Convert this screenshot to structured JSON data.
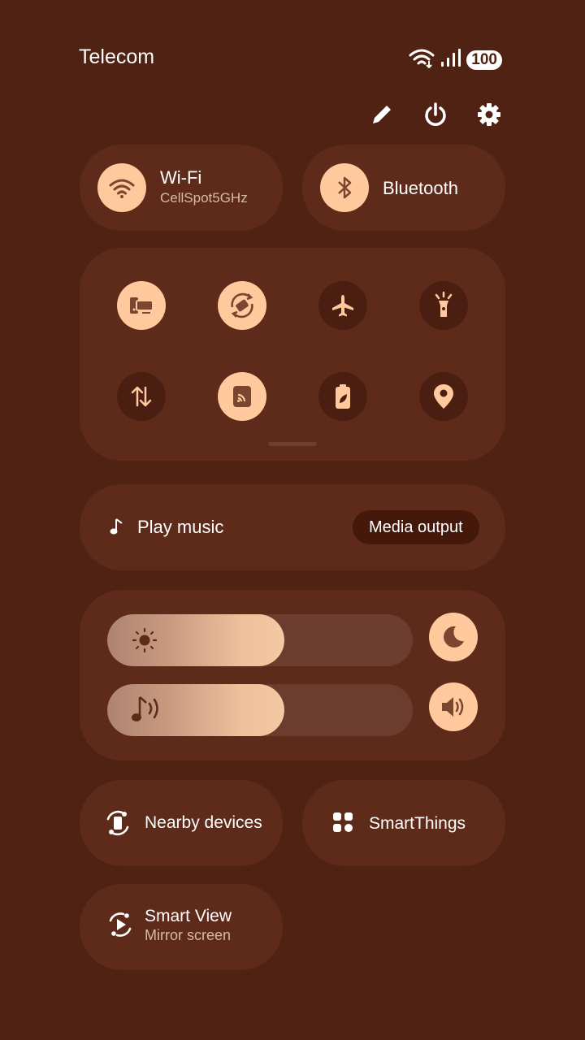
{
  "status_bar": {
    "carrier": "Telecom",
    "battery": "100"
  },
  "header_actions": [
    {
      "name": "edit",
      "icon": "pencil-icon"
    },
    {
      "name": "power",
      "icon": "power-icon"
    },
    {
      "name": "settings",
      "icon": "gear-icon"
    }
  ],
  "wifi": {
    "label": "Wi-Fi",
    "network": "CellSpot5GHz",
    "active": true
  },
  "bluetooth": {
    "label": "Bluetooth",
    "active": true
  },
  "quick_toggles": [
    {
      "icon": "screen-share-icon",
      "active": true
    },
    {
      "icon": "auto-rotate-icon",
      "active": true
    },
    {
      "icon": "airplane-icon",
      "active": false
    },
    {
      "icon": "flashlight-icon",
      "active": false
    },
    {
      "icon": "mobile-data-icon",
      "active": false
    },
    {
      "icon": "cast-icon",
      "active": true
    },
    {
      "icon": "power-saving-icon",
      "active": false
    },
    {
      "icon": "location-icon",
      "active": false
    }
  ],
  "media": {
    "label": "Play music",
    "output_button": "Media output"
  },
  "brightness": {
    "level": 0.58
  },
  "volume": {
    "level": 0.58
  },
  "nearby": {
    "label": "Nearby devices"
  },
  "smartthings": {
    "label": "SmartThings"
  },
  "smart_view": {
    "label": "Smart View",
    "sub": "Mirror screen"
  },
  "colors": {
    "background": "#4f2213",
    "panel": "#5e2b1b",
    "accent": "#ffc89d"
  }
}
